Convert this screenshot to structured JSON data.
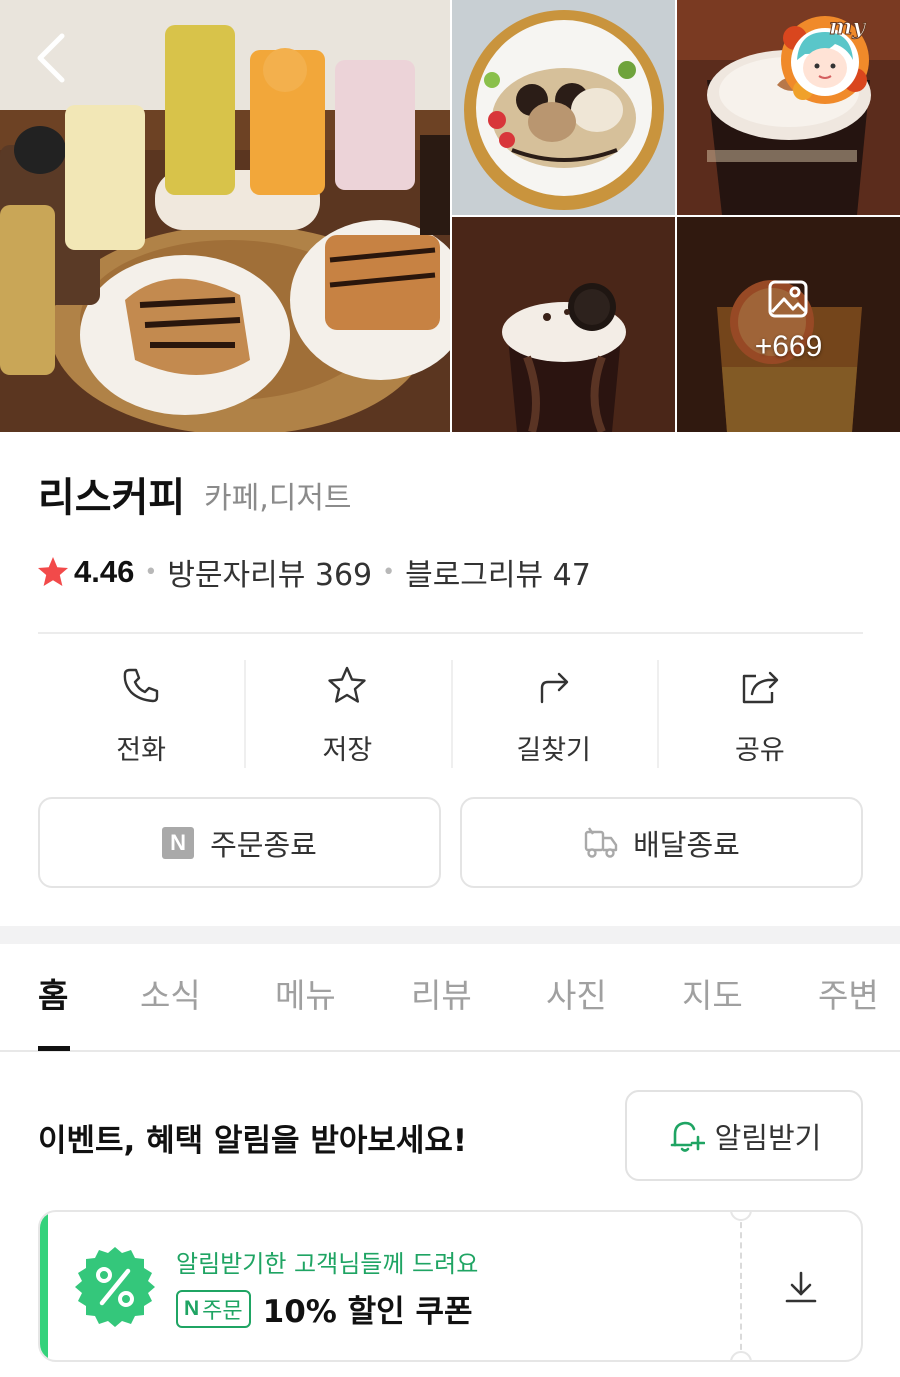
{
  "gallery": {
    "more_count": "+669",
    "avatar_text": "my"
  },
  "place": {
    "name": "리스커피",
    "category": "카페,디저트",
    "rating": "4.46",
    "visitor_reviews": "방문자리뷰 369",
    "blog_reviews": "블로그리뷰 47"
  },
  "actions": [
    {
      "label": "전화",
      "icon": "phone-icon"
    },
    {
      "label": "저장",
      "icon": "star-outline-icon"
    },
    {
      "label": "길찾기",
      "icon": "directions-icon"
    },
    {
      "label": "공유",
      "icon": "share-icon"
    }
  ],
  "order": {
    "n_badge": "N",
    "order_label": "주문종료",
    "delivery_label": "배달종료"
  },
  "tabs": [
    "홈",
    "소식",
    "메뉴",
    "리뷰",
    "사진",
    "지도",
    "주변"
  ],
  "alert": {
    "text": "이벤트, 혜택 알림을 받아보세요!",
    "button_label": "알림받기"
  },
  "coupon": {
    "subtitle": "알림받기한 고객님들께 드려요",
    "pay_badge_n": "N",
    "pay_badge_text": "주문",
    "title": "10% 할인 쿠폰"
  },
  "colors": {
    "star": "#f24a4a",
    "green": "#1fa463",
    "coupon_bar": "#34d27b"
  }
}
